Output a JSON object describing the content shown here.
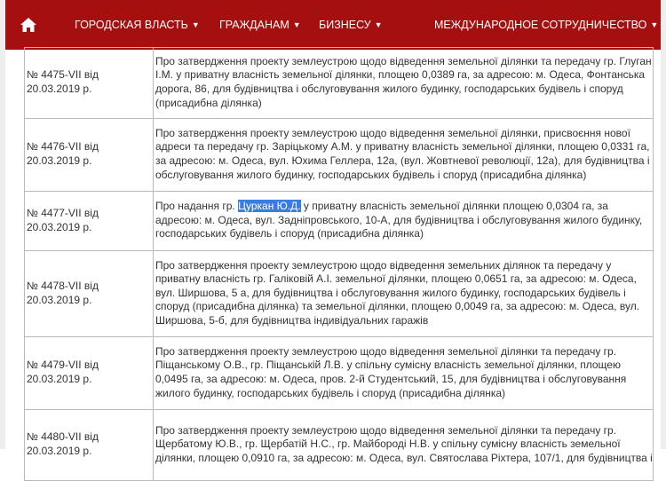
{
  "nav": {
    "items": [
      {
        "label": "ГОРОДСКАЯ ВЛАСТЬ"
      },
      {
        "label": "ГРАЖДАНАМ"
      },
      {
        "label": "БИЗНЕСУ"
      },
      {
        "label": "МЕЖДУНАРОДНОЕ СОТРУДНИЧЕСТВО"
      }
    ]
  },
  "rows": [
    {
      "number": "№ 4475-VII від 20.03.2019 р.",
      "text": "Про затвердження проекту землеустрою щодо відведення земельної ділянки та передачу гр. Глуган І.М. у приватну власність земельної ділянки, площею 0,0389 га, за адресою: м. Одеса, Фонтанська дорога, 86, для будівництва і обслуговування жилого будинку, господарських будівель і споруд (присадибна ділянка)"
    },
    {
      "number": "№ 4476-VII від 20.03.2019 р.",
      "text": "Про затвердження проекту землеустрою щодо відведення земельної ділянки, присвоєння нової адреси та передачу гр. Зарiцькому А.М. у приватну власність земельної ділянки, площею 0,0331 га, за адресою: м. Одеса, вул. Юхима Геллера, 12а, (вул. Жовтневої революції, 12а), для будівництва і обслуговування жилого будинку, господарських будівель і споруд (присадибна ділянка)"
    },
    {
      "number": "№ 4477-VII від 20.03.2019 р.",
      "text_before": "Про надання гр. ",
      "text_highlight": "Цуркан Ю.Д.",
      "text_after": " у приватну власність земельної ділянки площею 0,0304 га, за адресою: м. Одеса, вул. Задніпровського, 10-А, для будівництва і обслуговування жилого будинку, господарських будівель і споруд (присадибна ділянка)"
    },
    {
      "number": "№ 4478-VII від 20.03.2019 р.",
      "text": "Про затвердження проекту землеустрою щодо відведення земельних ділянок та передачу у приватну власність гр. Галіковій А.І. земельної ділянки, площею 0,0651 га, за адресою: м. Одеса, вул. Ширшова, 5 а, для будівництва і обслуговування жилого будинку, господарських будівель і споруд (присадибна ділянка) та земельної ділянки, площею 0,0049 га, за адресою: м. Одеса, вул. Ширшова, 5-б, для будівництва індивідуальних гаражів"
    },
    {
      "number": "№ 4479-VII від 20.03.2019 р.",
      "text": "Про затвердження проекту землеустрою щодо відведення земельної ділянки та передачу гр. Піщанському О.В., гр. Піщанській Л.В. у спільну сумісну власність земельної ділянки, площею 0,0495 га, за адресою: м. Одеса, пров. 2-й Студентський, 15, для будівництва і обслуговування жилого будинку, господарських будівель і споруд (присадибна ділянка)"
    },
    {
      "number": "№ 4480-VII від 20.03.2019 р.",
      "text": "Про затвердження проекту землеустрою щодо відведення земельної ділянки та передачу гр. Щербатому Ю.В., гр. Щербатій Н.С., гр. Майбороді Н.В. у спільну сумісну власність земельної ділянки, площею 0,0910 га, за адресою: м. Одеса, вул. Святослава Ріхтера, 107/1, для будівництва і"
    }
  ]
}
